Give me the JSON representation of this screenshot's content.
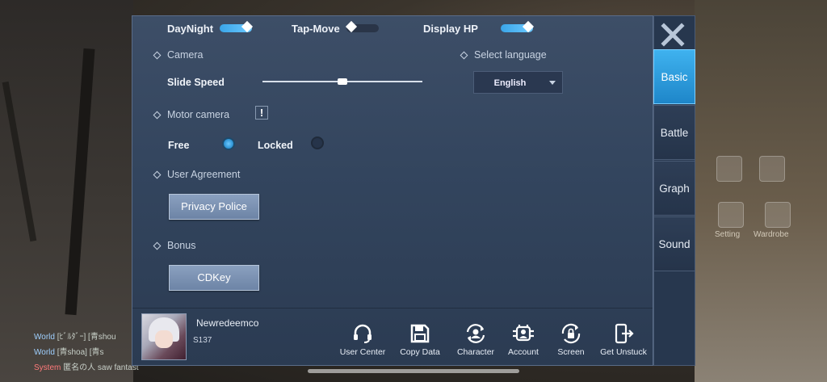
{
  "toggles": [
    {
      "label": "DayNight",
      "on": true
    },
    {
      "label": "Tap-Move",
      "on": false
    },
    {
      "label": "Display HP",
      "on": true
    }
  ],
  "camera": {
    "section": "Camera",
    "slide_speed_label": "Slide Speed",
    "slide_speed_value": 0.5
  },
  "language": {
    "section": "Select language",
    "selected": "English"
  },
  "motor_camera": {
    "section": "Motor camera",
    "warn_glyph": "!",
    "options": [
      {
        "label": "Free",
        "selected": true
      },
      {
        "label": "Locked",
        "selected": false
      }
    ]
  },
  "user_agreement": {
    "section": "User Agreement",
    "button": "Privacy Police"
  },
  "bonus": {
    "section": "Bonus",
    "button": "CDKey"
  },
  "player": {
    "name": "Newredeemco",
    "server": "S137"
  },
  "footer_buttons": [
    {
      "label": "User Center",
      "icon": "headset-icon"
    },
    {
      "label": "Copy Data",
      "icon": "save-icon"
    },
    {
      "label": "Character",
      "icon": "character-swap-icon"
    },
    {
      "label": "Account",
      "icon": "account-swap-icon"
    },
    {
      "label": "Screen",
      "icon": "screen-lock-icon"
    },
    {
      "label": "Get Unstuck",
      "icon": "phone-exit-icon"
    }
  ],
  "tabs": [
    {
      "label": "Basic",
      "active": true
    },
    {
      "label": "Battle",
      "active": false
    },
    {
      "label": "Graph",
      "active": false
    },
    {
      "label": "Sound",
      "active": false
    }
  ],
  "background_hud": {
    "labels": [
      "Setting",
      "Wardrobe"
    ],
    "chat": [
      {
        "channel": "World",
        "text": "[ﾋﾞﾙﾀﾞｰ] [青shou"
      },
      {
        "channel": "World",
        "text": "[青shoa] [青s"
      },
      {
        "channel": "System",
        "text": "匿名の人 saw fantastic night when"
      }
    ]
  },
  "colors": {
    "accent": "#3fb2ef",
    "panel": "#33455e"
  }
}
